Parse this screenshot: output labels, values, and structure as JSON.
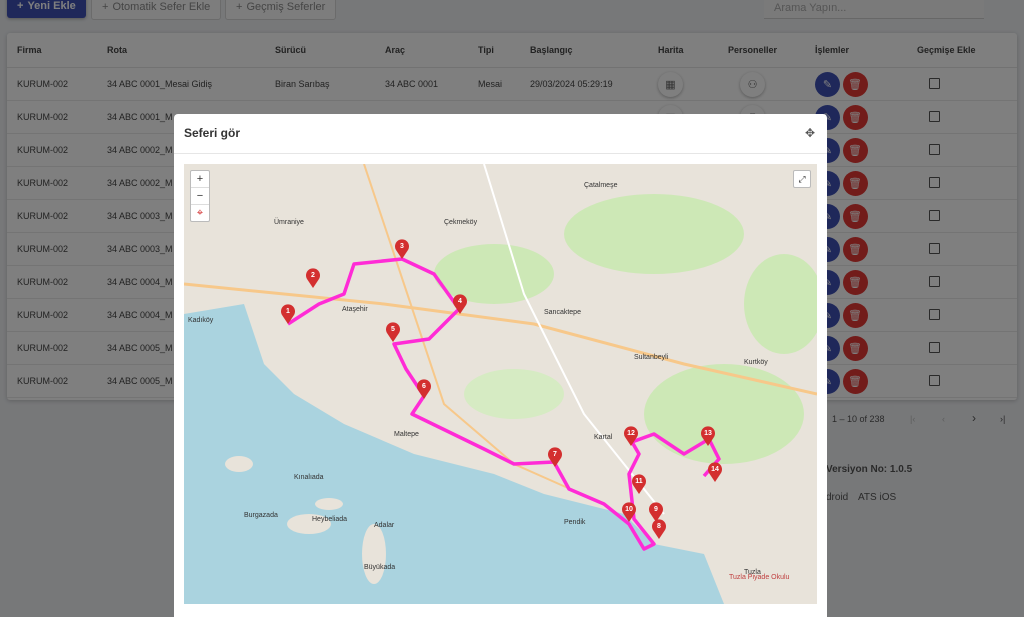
{
  "toolbar": {
    "new_label": "Yeni Ekle",
    "auto_label": "Otomatik Sefer Ekle",
    "history_label": "Geçmiş Seferler",
    "search_placeholder": "Arama Yapın..."
  },
  "table": {
    "headers": [
      "Firma",
      "Rota",
      "Sürücü",
      "Araç",
      "Tipi",
      "Başlangıç",
      "Harita",
      "Personeller",
      "İşlemler",
      "Geçmişe Ekle"
    ],
    "rows": [
      {
        "firma": "KURUM-002",
        "rota": "34 ABC 0001_Mesai Gidiş",
        "surucu": "Biran Sarıbaş",
        "arac": "34 ABC 0001",
        "tipi": "Mesai",
        "baslangic": "29/03/2024 05:29:19"
      },
      {
        "firma": "KURUM-002",
        "rota": "34 ABC 0001_M"
      },
      {
        "firma": "KURUM-002",
        "rota": "34 ABC 0002_M"
      },
      {
        "firma": "KURUM-002",
        "rota": "34 ABC 0002_M"
      },
      {
        "firma": "KURUM-002",
        "rota": "34 ABC 0003_M"
      },
      {
        "firma": "KURUM-002",
        "rota": "34 ABC 0003_M"
      },
      {
        "firma": "KURUM-002",
        "rota": "34 ABC 0004_M"
      },
      {
        "firma": "KURUM-002",
        "rota": "34 ABC 0004_M"
      },
      {
        "firma": "KURUM-002",
        "rota": "34 ABC 0005_M"
      },
      {
        "firma": "KURUM-002",
        "rota": "34 ABC 0005_M"
      }
    ]
  },
  "pagination": {
    "range": "1 – 10 of 238"
  },
  "footer": {
    "version": "Versiyon No: 1.0.5",
    "android": "droid",
    "ios": "ATS iOS"
  },
  "modal": {
    "title": "Seferi gör",
    "zoom_in": "+",
    "zoom_out": "−",
    "locate": "⌖",
    "fullscreen": "⤢",
    "markers": [
      "1",
      "2",
      "3",
      "4",
      "5",
      "6",
      "7",
      "8",
      "9",
      "10",
      "11",
      "12",
      "13",
      "14"
    ],
    "map_labels": [
      "Kadıköy",
      "Ataşehir",
      "Maltepe",
      "Çekmeköy",
      "Sancaktepe",
      "Sultanbeyli",
      "Kartal",
      "Pendik",
      "Tuzla",
      "Adalar",
      "Ümraniye",
      "Çatalmeşe",
      "Kurtköy",
      "Tuzla Piyade Okulu",
      "Büyükada",
      "Heybeliada",
      "Burgazada",
      "Kınalıada"
    ]
  },
  "colors": {
    "primary": "#3f51b5",
    "danger": "#e53935",
    "route": "#ff2bd6",
    "marker": "#d32f2f"
  }
}
